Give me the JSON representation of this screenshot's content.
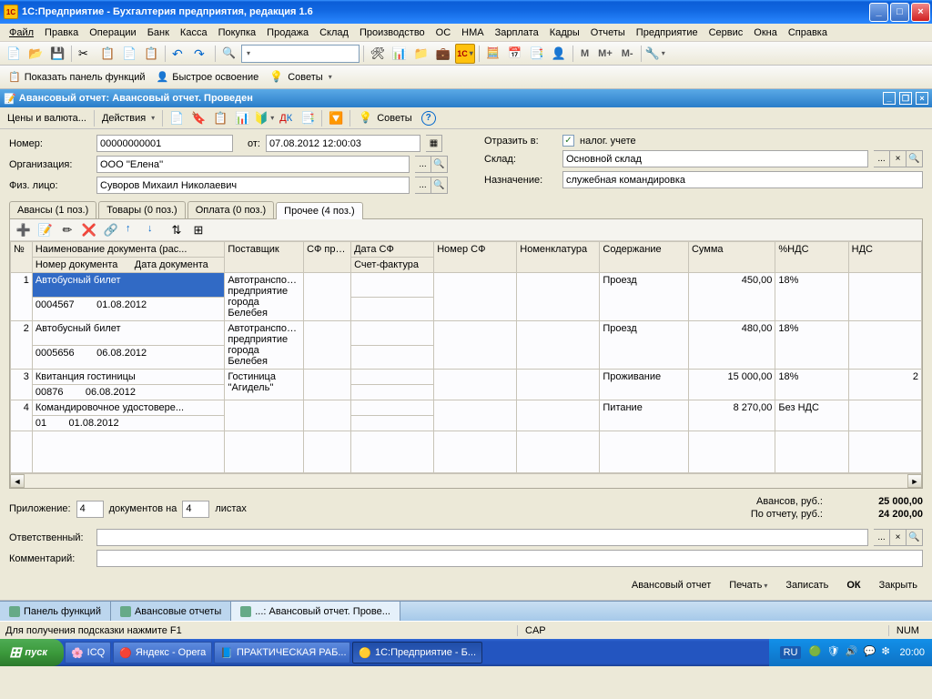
{
  "title": "1С:Предприятие - Бухгалтерия предприятия, редакция 1.6",
  "menu": [
    "Файл",
    "Правка",
    "Операции",
    "Банк",
    "Касса",
    "Покупка",
    "Продажа",
    "Склад",
    "Производство",
    "ОС",
    "НМА",
    "Зарплата",
    "Кадры",
    "Отчеты",
    "Предприятие",
    "Сервис",
    "Окна",
    "Справка"
  ],
  "toolbar2": {
    "panel": "Показать панель функций",
    "quick": "Быстрое освоение",
    "tips": "Советы"
  },
  "mtxt": {
    "m": "М",
    "mp": "М+",
    "mm": "М-"
  },
  "doc": {
    "header": "Авансовый отчет: Авансовый отчет. Проведен",
    "actions_lbl": "Действия",
    "prices_lbl": "Цены и валюта...",
    "tips": "Советы",
    "labels": {
      "number": "Номер:",
      "from": "от:",
      "org": "Организация:",
      "person": "Физ. лицо:",
      "reflect": "Отразить в:",
      "tax": "налог. учете",
      "warehouse": "Склад:",
      "purpose": "Назначение:"
    },
    "number": "00000000001",
    "date": "07.08.2012 12:00:03",
    "org": "ООО ''Елена''",
    "person": "Суворов Михаил Николаевич",
    "warehouse": "Основной склад",
    "purpose": "служебная командировка"
  },
  "tabs": [
    "Авансы (1 поз.)",
    "Товары (0 поз.)",
    "Оплата (0 поз.)",
    "Прочее (4 поз.)"
  ],
  "grid": {
    "headers": {
      "n": "№",
      "docname": "Наименование документа (рас...",
      "docnum": "Номер документа",
      "docdate": "Дата документа",
      "supplier": "Поставщик",
      "sf": "СФ пред...",
      "sfdate": "Дата СФ",
      "sfacc": "Счет-фактура",
      "sfnum": "Номер СФ",
      "nomen": "Номенклатура",
      "content": "Содержание",
      "sum": "Сумма",
      "vatpct": "%НДС",
      "vat": "НДС"
    },
    "rows": [
      {
        "n": "1",
        "docname": "Автобусный   билет",
        "docnum": "0004567",
        "docdate": "01.08.2012",
        "supplier": "Автотранспорт... предприятие города Белебея",
        "content": "Проезд",
        "sum": "450,00",
        "vatpct": "18%",
        "vat": ""
      },
      {
        "n": "2",
        "docname": "Автобусный билет",
        "docnum": "0005656",
        "docdate": "06.08.2012",
        "supplier": "Автотранспорт... предприятие города Белебея",
        "content": "Проезд",
        "sum": "480,00",
        "vatpct": "18%",
        "vat": ""
      },
      {
        "n": "3",
        "docname": "Квитанция гостиницы",
        "docnum": "00876",
        "docdate": "06.08.2012",
        "supplier": "Гостиница ''Агидель''",
        "content": "Проживание",
        "sum": "15 000,00",
        "vatpct": "18%",
        "vat": "2"
      },
      {
        "n": "4",
        "docname": "Командировочное удостовере...",
        "docnum": "01",
        "docdate": "01.08.2012",
        "supplier": "",
        "content": "Питание",
        "sum": "8 270,00",
        "vatpct": "Без НДС",
        "vat": ""
      }
    ]
  },
  "summary": {
    "attach_lbl": "Приложение:",
    "docs_count": "4",
    "docs_on": "документов на",
    "sheets": "4",
    "sheets_lbl": "листах",
    "advances_lbl": "Авансов, руб.:",
    "advances": "25 000,00",
    "report_lbl": "По отчету, руб.:",
    "report": "24 200,00"
  },
  "bottom": {
    "resp": "Ответственный:",
    "comment": "Комментарий:"
  },
  "cmds": {
    "report": "Авансовый отчет",
    "print": "Печать",
    "save": "Записать",
    "ok": "ОК",
    "close": "Закрыть"
  },
  "wintabs": [
    "Панель функций",
    "Авансовые отчеты",
    "...: Авансовый отчет. Прове..."
  ],
  "status": {
    "hint": "Для получения подсказки нажмите F1",
    "cap": "CAP",
    "num": "NUM"
  },
  "taskbar": {
    "start": "пуск",
    "items": [
      "ICQ",
      "Яндекс - Opera",
      "ПРАКТИЧЕСКАЯ РАБ...",
      "1С:Предприятие - Б..."
    ],
    "lang": "RU",
    "time": "20:00"
  }
}
